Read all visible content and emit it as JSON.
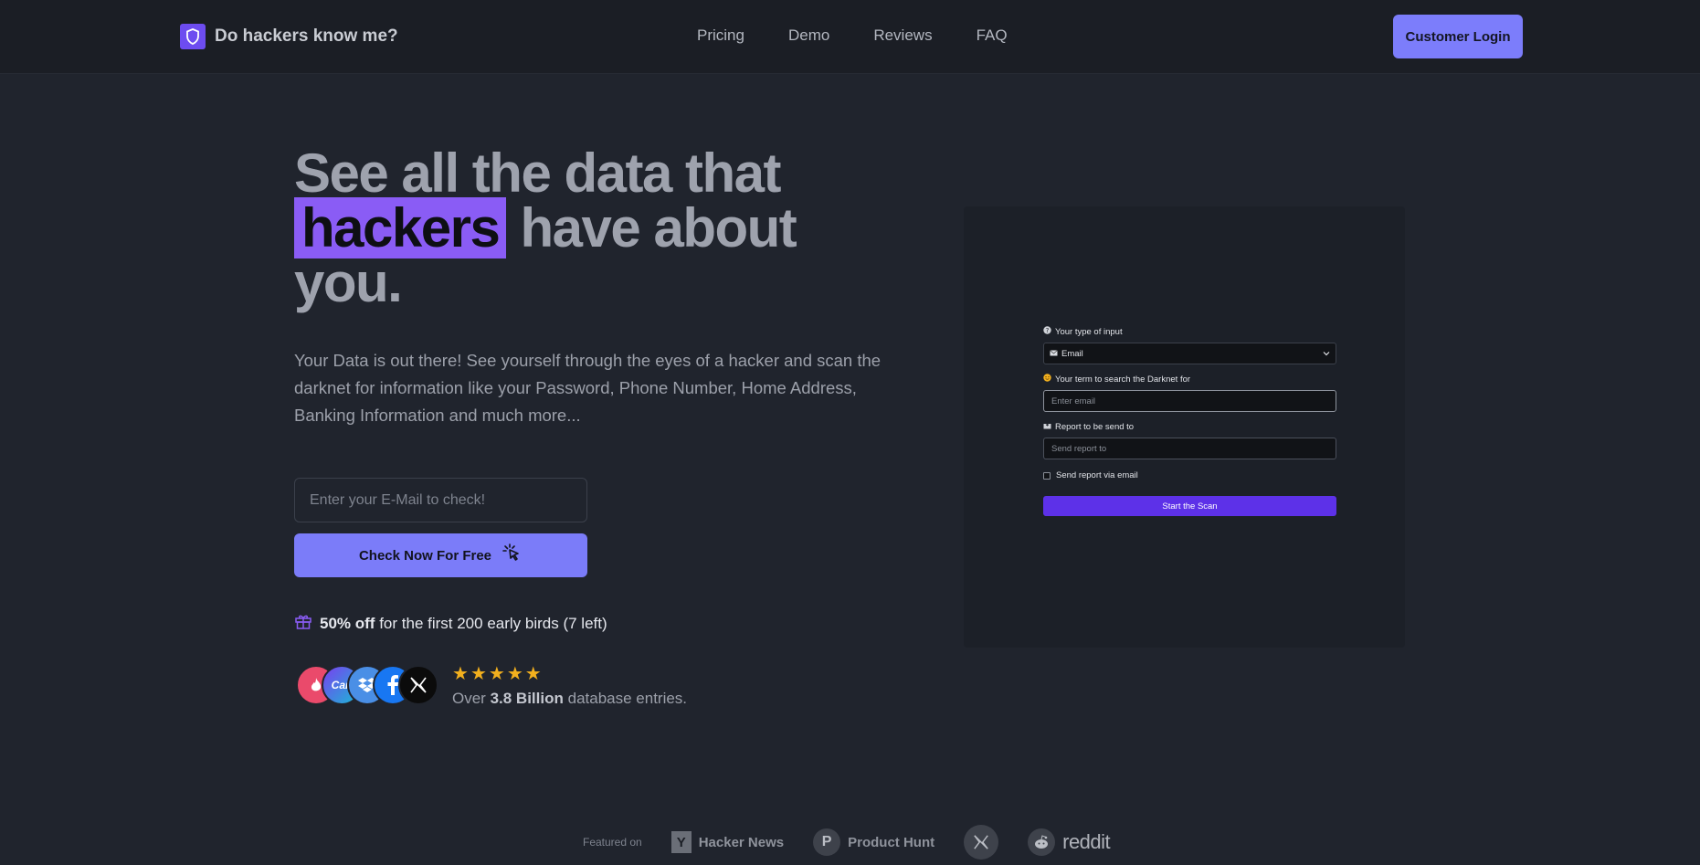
{
  "navbar": {
    "brand": "Do hackers know me?",
    "links": [
      "Pricing",
      "Demo",
      "Reviews",
      "FAQ"
    ],
    "login_label": "Customer Login"
  },
  "hero": {
    "title_part1": "See all the data that",
    "title_highlight": "hackers",
    "title_part2": "have about you.",
    "description": "Your Data is out there! See yourself through the eyes of a hacker and scan the darknet for information like your Password, Phone Number, Home Address, Banking Information and much more...",
    "email_placeholder": "Enter your E-Mail to check!",
    "cta_label": "Check Now For Free",
    "promo_bold": "50% off",
    "promo_rest": "for the first 200 early birds (7 left)",
    "avatars": [
      "tinder",
      "Can",
      "dropbox",
      "facebook",
      "X"
    ],
    "stars": 5,
    "stat_prefix": "Over",
    "stat_bold": "3.8 Billion",
    "stat_suffix": "database entries."
  },
  "demo": {
    "input_type_label": "Your type of input",
    "input_type_value": "Email",
    "search_term_label": "Your term to search the Darknet for",
    "search_term_placeholder": "Enter email",
    "report_label": "Report to be send to",
    "report_placeholder": "Send report to",
    "checkbox_label": "Send report via email",
    "button_label": "Start the Scan"
  },
  "featured": {
    "label": "Featured on",
    "hn": "Hacker News",
    "ph": "Product Hunt",
    "reddit": "reddit"
  },
  "colors": {
    "background": "#20242d",
    "navbar": "#1b1e25",
    "accent": "#7b7cf9",
    "highlight": "#8a5cf5",
    "demo_button": "#5d31e8",
    "star": "#f2b01e"
  }
}
